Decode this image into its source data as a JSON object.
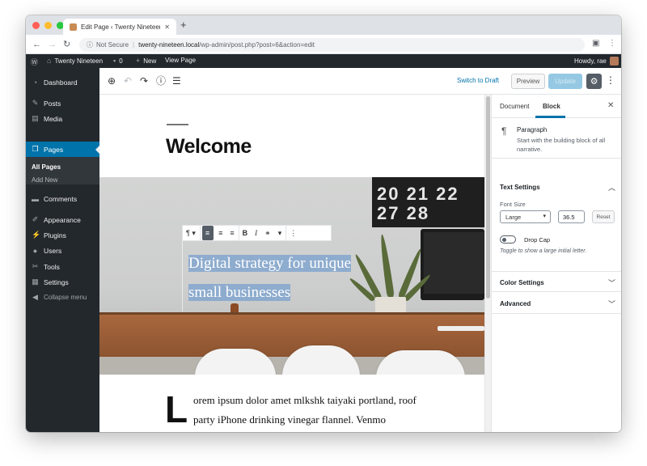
{
  "browser": {
    "tab_title": "Edit Page ‹ Twenty Nineteen —",
    "new_tab": "+",
    "security": "Not Secure",
    "url_host": "twenty-nineteen.local",
    "url_path": "/wp-admin/post.php?post=6&action=edit"
  },
  "adminbar": {
    "site_name": "Twenty Nineteen",
    "comments_count": "0",
    "new_label": "New",
    "view_page": "View Page",
    "howdy": "Howdy, rae"
  },
  "sidebar": {
    "items": [
      {
        "label": "Dashboard",
        "icon": "dashboard-icon"
      },
      {
        "label": "Posts",
        "icon": "pin-icon"
      },
      {
        "label": "Media",
        "icon": "media-icon"
      },
      {
        "label": "Pages",
        "icon": "pages-icon"
      },
      {
        "label": "Comments",
        "icon": "comment-icon"
      },
      {
        "label": "Appearance",
        "icon": "brush-icon"
      },
      {
        "label": "Plugins",
        "icon": "plug-icon"
      },
      {
        "label": "Users",
        "icon": "user-icon"
      },
      {
        "label": "Tools",
        "icon": "wrench-icon"
      },
      {
        "label": "Settings",
        "icon": "settings-icon"
      }
    ],
    "sub_items": [
      "All Pages",
      "Add New"
    ],
    "collapse": "Collapse menu"
  },
  "editor": {
    "switch_draft": "Switch to Draft",
    "preview": "Preview",
    "update": "Update",
    "page_title": "Welcome",
    "cover_text": "Digital strategy for unique small businesses",
    "drop_cap": "L",
    "body_text": "orem ipsum dolor amet mlkshk taiyaki portland, roof party iPhone drinking vinegar flannel. Venmo",
    "calendar_rows": [
      "20 21 22",
      "27 28"
    ]
  },
  "inspector": {
    "tab_document": "Document",
    "tab_block": "Block",
    "block_name": "Paragraph",
    "block_desc": "Start with the building block of all narrative.",
    "text_settings": "Text Settings",
    "font_size_label": "Font Size",
    "font_size_value": "Large",
    "font_size_number": "36.5",
    "reset": "Reset",
    "drop_cap_label": "Drop Cap",
    "drop_cap_help": "Toggle to show a large initial letter.",
    "color_settings": "Color Settings",
    "advanced": "Advanced"
  },
  "colors": {
    "admin_dark": "#23282d",
    "accent_blue": "#0073aa",
    "update_disabled": "#95c8e3"
  }
}
